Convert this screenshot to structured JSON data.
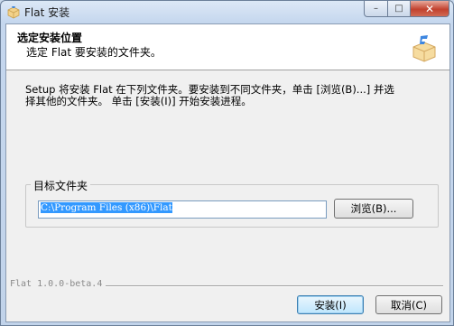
{
  "window": {
    "title": "Flat 安装"
  },
  "caption": {
    "minimize": "–",
    "maximize": "□",
    "close": "✕"
  },
  "header": {
    "title": "选定安装位置",
    "subtitle": "选定 Flat 要安装的文件夹。"
  },
  "description": {
    "line1": "Setup 将安装 Flat 在下列文件夹。要安装到不同文件夹，单击 [浏览(B)...] 并选",
    "line2": "择其他的文件夹。 单击 [安装(I)] 开始安装进程。"
  },
  "destination": {
    "label": "目标文件夹",
    "path": "C:\\Program Files (x86)\\Flat",
    "browse_label": "浏览(B)..."
  },
  "footer": {
    "brand": "Flat 1.0.0-beta.4",
    "install_label": "安装(I)",
    "cancel_label": "取消(C)"
  },
  "icons": {
    "title": "flat-app-icon",
    "header": "package-box-icon"
  },
  "colors": {
    "accent": "#3399ff",
    "close_button": "#c2412e"
  }
}
